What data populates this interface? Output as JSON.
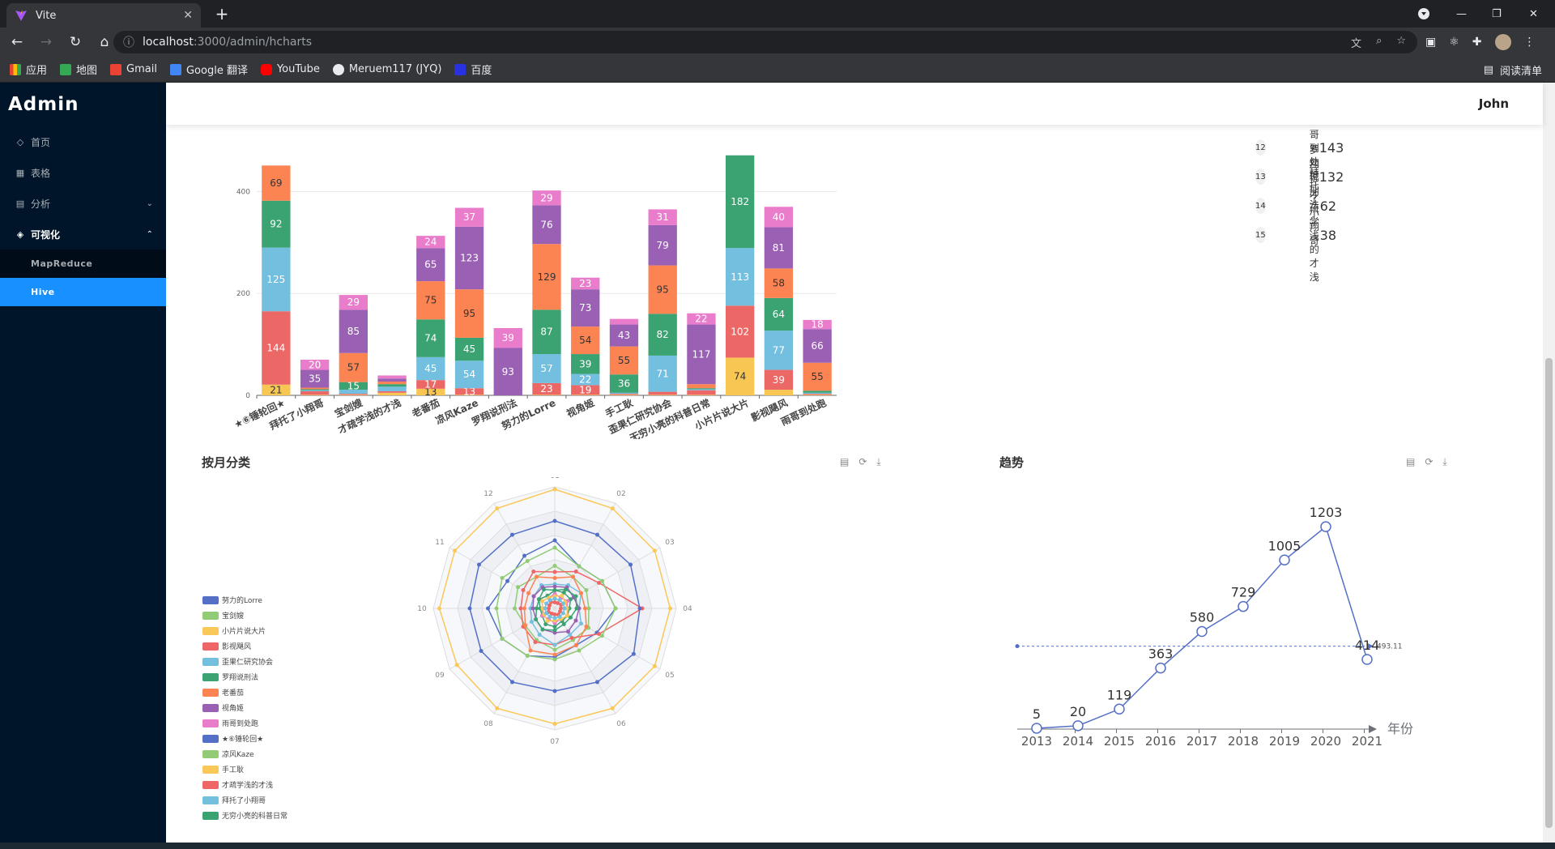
{
  "browser": {
    "tab_title": "Vite",
    "url_host": "localhost",
    "url_rest": ":3000/admin/hcharts",
    "bookmarks": [
      "应用",
      "地图",
      "Gmail",
      "Google 翻译",
      "YouTube",
      "Meruem117 (JYQ)",
      "百度"
    ],
    "bookmark_colors": [
      "#e8eaed",
      "#34a853",
      "#ea4335",
      "#4285f4",
      "#ff0000",
      "#e8eaed",
      "#2932e1"
    ],
    "reading_list": "阅读清单"
  },
  "sidebar": {
    "logo": "Admin",
    "items": [
      {
        "label": "首页",
        "icon": "home-icon"
      },
      {
        "label": "表格",
        "icon": "table-icon"
      },
      {
        "label": "分析",
        "icon": "analysis-icon"
      },
      {
        "label": "可视化",
        "icon": "visual-icon"
      }
    ],
    "subitems": [
      {
        "label": "MapReduce"
      },
      {
        "label": "Hive"
      }
    ]
  },
  "header": {
    "user": "John"
  },
  "ranking": [
    {
      "no": "12",
      "name": "雨哥到处跑",
      "value": "143"
    },
    {
      "no": "13",
      "name": "罗翔说刑法",
      "value": "132"
    },
    {
      "no": "14",
      "name": "拜托了小翔哥",
      "value": "62"
    },
    {
      "no": "15",
      "name": "才疏学浅的才浅",
      "value": "38"
    }
  ],
  "sections": {
    "month_title": "按月分类",
    "trend_title": "趋势"
  },
  "chart_data": [
    {
      "type": "bar",
      "stacked": true,
      "categories": [
        "★⑥锤轮回★",
        "拜托了小翔哥",
        "宝剑嫂",
        "才疏学浅的才浅",
        "老番茄",
        "凉风Kaze",
        "罗翔说刑法",
        "努力的Lorre",
        "视角姬",
        "手工耿",
        "歪果仁研究协会",
        "无穷小亮的科普日常",
        "小片片说大片",
        "影视飓风",
        "雨哥到处跑"
      ],
      "ylim": [
        0,
        400
      ],
      "yticks": [
        0,
        200,
        400
      ],
      "series": [
        {
          "color": "#f7c653",
          "values": [
            21,
            1,
            1,
            5,
            13,
            1,
            0,
            1,
            1,
            1,
            1,
            1,
            74,
            11,
            1
          ]
        },
        {
          "color": "#ec6867",
          "values": [
            144,
            7,
            2,
            3,
            17,
            13,
            0,
            23,
            19,
            2,
            6,
            9,
            102,
            39,
            2
          ]
        },
        {
          "color": "#73bfe0",
          "values": [
            125,
            2,
            8,
            9,
            45,
            54,
            0,
            57,
            22,
            2,
            71,
            2,
            113,
            77,
            2
          ]
        },
        {
          "color": "#3ba272",
          "values": [
            92,
            2,
            15,
            5,
            74,
            45,
            0,
            87,
            39,
            36,
            82,
            2,
            182,
            64,
            4
          ]
        },
        {
          "color": "#fc8452",
          "values": [
            69,
            3,
            57,
            5,
            75,
            95,
            0,
            129,
            54,
            55,
            95,
            8,
            0,
            58,
            55
          ]
        },
        {
          "color": "#9a60b4",
          "values": [
            0,
            35,
            85,
            6,
            65,
            123,
            93,
            76,
            73,
            43,
            79,
            117,
            0,
            81,
            66
          ]
        },
        {
          "color": "#ea7ccc",
          "values": [
            0,
            20,
            29,
            6,
            24,
            37,
            39,
            29,
            23,
            11,
            31,
            22,
            0,
            40,
            18
          ]
        }
      ]
    },
    {
      "type": "radar",
      "indicators": [
        "01",
        "02",
        "03",
        "04",
        "05",
        "06",
        "07",
        "08",
        "09",
        "10",
        "11",
        "12"
      ],
      "series": [
        {
          "name": "努力的Lorre",
          "color": "#5470c6",
          "values": [
            0.56,
            0.4,
            0.45,
            0.5,
            0.4,
            0.35,
            0.4,
            0.45,
            0.5,
            0.55,
            0.45,
            0.5
          ]
        },
        {
          "name": "宝剑嫂",
          "color": "#91cc75",
          "values": [
            0.35,
            0.3,
            0.3,
            0.28,
            0.32,
            0.3,
            0.34,
            0.3,
            0.28,
            0.33,
            0.35,
            0.3
          ]
        },
        {
          "name": "小片片说大片",
          "color": "#fac858",
          "values": [
            0.98,
            0.95,
            0.95,
            0.95,
            0.95,
            0.95,
            0.95,
            0.95,
            0.93,
            0.95,
            0.95,
            0.95
          ]
        },
        {
          "name": "影视飓风",
          "color": "#ee6666",
          "values": [
            0.3,
            0.35,
            0.42,
            0.72,
            0.42,
            0.28,
            0.3,
            0.32,
            0.3,
            0.28,
            0.3,
            0.35
          ]
        },
        {
          "name": "歪果仁研究协会",
          "color": "#73c0de",
          "values": [
            0.2,
            0.22,
            0.25,
            0.2,
            0.25,
            0.25,
            0.3,
            0.25,
            0.22,
            0.2,
            0.2,
            0.22
          ]
        },
        {
          "name": "罗翔说刑法",
          "color": "#3ba272",
          "values": [
            0.15,
            0.15,
            0.15,
            0.12,
            0.12,
            0.12,
            0.15,
            0.15,
            0.12,
            0.12,
            0.15,
            0.12
          ]
        },
        {
          "name": "老番茄",
          "color": "#fc8452",
          "values": [
            0.25,
            0.3,
            0.25,
            0.25,
            0.3,
            0.35,
            0.38,
            0.4,
            0.28,
            0.25,
            0.25,
            0.3
          ]
        },
        {
          "name": "视角姬",
          "color": "#9a60b4",
          "values": [
            0.18,
            0.2,
            0.18,
            0.2,
            0.2,
            0.22,
            0.2,
            0.2,
            0.18,
            0.18,
            0.2,
            0.2
          ]
        },
        {
          "name": "雨哥到处跑",
          "color": "#ea7ccc",
          "values": [
            0.12,
            0.1,
            0.12,
            0.1,
            0.12,
            0.1,
            0.12,
            0.1,
            0.12,
            0.1,
            0.12,
            0.1
          ]
        },
        {
          "name": "★⑥锤轮回★",
          "color": "#5470c6",
          "values": [
            0.72,
            0.7,
            0.72,
            0.7,
            0.75,
            0.7,
            0.68,
            0.7,
            0.7,
            0.7,
            0.72,
            0.7
          ]
        },
        {
          "name": "凉风Kaze",
          "color": "#91cc75",
          "values": [
            0.5,
            0.4,
            0.45,
            0.5,
            0.45,
            0.4,
            0.42,
            0.45,
            0.5,
            0.48,
            0.5,
            0.45
          ]
        },
        {
          "name": "手工耿",
          "color": "#fac858",
          "values": [
            0.1,
            0.12,
            0.1,
            0.1,
            0.12,
            0.1,
            0.1,
            0.12,
            0.1,
            0.1,
            0.12,
            0.1
          ]
        },
        {
          "name": "才疏学浅的才浅",
          "color": "#ee6666",
          "values": [
            0.05,
            0.05,
            0.06,
            0.05,
            0.05,
            0.06,
            0.05,
            0.05,
            0.06,
            0.05,
            0.05,
            0.06
          ]
        },
        {
          "name": "拜托了小翔哥",
          "color": "#73c0de",
          "values": [
            0.08,
            0.08,
            0.08,
            0.08,
            0.08,
            0.08,
            0.08,
            0.08,
            0.08,
            0.08,
            0.08,
            0.08
          ]
        },
        {
          "name": "无穷小亮的科普日常",
          "color": "#3ba272",
          "values": [
            0.15,
            0.18,
            0.2,
            0.18,
            0.15,
            0.15,
            0.18,
            0.2,
            0.18,
            0.15,
            0.15,
            0.18
          ]
        }
      ]
    },
    {
      "type": "line",
      "x": [
        "2013",
        "2014",
        "2015",
        "2016",
        "2017",
        "2018",
        "2019",
        "2020",
        "2021"
      ],
      "values": [
        5,
        20,
        119,
        363,
        580,
        729,
        1005,
        1203,
        414
      ],
      "xlabel": "年份",
      "markline_value": "493.11",
      "ylim": [
        0,
        1300
      ]
    }
  ]
}
